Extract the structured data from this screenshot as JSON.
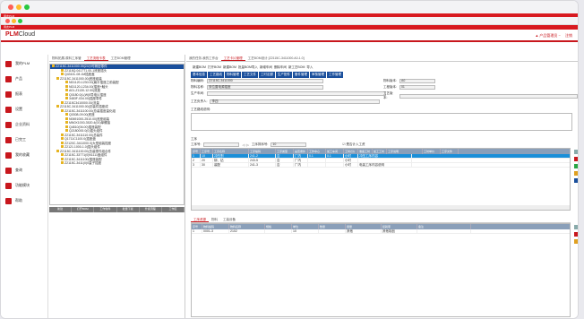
{
  "window": {
    "title1": "用友PLM",
    "title2": "用友PLM"
  },
  "app": {
    "logo_prefix": "PLM",
    "logo_suffix": "Cloud",
    "user": "产品管理员 ~",
    "logout": "注销"
  },
  "sidebar": {
    "items": [
      {
        "label": "我的PLM"
      },
      {
        "label": "产品"
      },
      {
        "label": "报表"
      },
      {
        "label": "设置"
      },
      {
        "label": "企业资料"
      },
      {
        "label": "已完工"
      },
      {
        "label": "我的收藏"
      },
      {
        "label": "查询"
      },
      {
        "label": "功能模块"
      },
      {
        "label": "帮助"
      }
    ]
  },
  "tree": {
    "tabs": [
      "物料拓展-原料工序管",
      "工艺流程卡表",
      "工艺BOM管理"
    ],
    "nodes": [
      {
        "text": "Z2115C-3411000.09(24小时精密零件",
        "sel": true,
        "indent": 0
      },
      {
        "text": "Z2115Q.0417T1.00-1底座插头",
        "indent": 2
      },
      {
        "text": "Q4310L.08.1M插座盖",
        "indent": 2
      },
      {
        "text": "Z2115C-3411000.00(底座组装",
        "indent": 1
      },
      {
        "text": "ND1120-1230.00(扁平插座之前装配",
        "indent": 3
      },
      {
        "text": "ND1120-1234.00(插座+触头",
        "indent": 3
      },
      {
        "text": "A01-Z1130-12.00(底座",
        "indent": 3
      },
      {
        "text": "Q0180.0(L(W)5导电片插座",
        "indent": 3
      },
      {
        "text": "3483F-034.00(插座零件",
        "indent": 3
      },
      {
        "text": "Z2115C3410000.00(流量",
        "indent": 2
      },
      {
        "text": "Z2115C-3411000.00(总装件插座成",
        "indent": 1
      },
      {
        "text": "Z2115C-3411100.00(总装插座量化组",
        "indent": 2
      },
      {
        "text": "Q0308-09.00(底座",
        "indent": 3
      },
      {
        "text": "N0691000-2510.00(底座组装",
        "indent": 3
      },
      {
        "text": "MN0X1000-3520.4(00)单螺接",
        "indent": 3
      },
      {
        "text": "Q4810(06.00)插座装配",
        "indent": 3
      },
      {
        "text": "Q2180000.0(0)插头组件",
        "indent": 3
      },
      {
        "text": "Z2115C-3411110.00(总装件",
        "indent": 2
      },
      {
        "text": "Q1711C1100.0(插座盘",
        "indent": 2
      },
      {
        "text": "Z2120C-3411000.0(大型组装插座",
        "indent": 2
      },
      {
        "text": "Z2121.1000-1.0(插头组件",
        "indent": 2
      },
      {
        "text": "Z2115C-3411100.00(总装零件组合件",
        "indent": 1
      },
      {
        "text": "Z2115C-33771(0)N1111盘组件",
        "indent": 2
      },
      {
        "text": "Z2115C-3411100(插座装配",
        "indent": 2
      },
      {
        "text": "Z2115C-3411(0)0量子插座",
        "indent": 2
      }
    ],
    "buttons": [
      "新建",
      "打开BOM",
      "工作零件",
      "批量下载",
      "升级流程",
      "工作区"
    ]
  },
  "main": {
    "tabs": [
      "我的任务-我的工作台",
      "工艺卡片管理",
      "工艺BOM设计 [Z2115C-3411000.A0-1.0]"
    ],
    "toolbar": [
      "新建BOM",
      "打开BOM",
      "新建BOM",
      "批量BOM导入",
      "新增车间",
      "删除车间",
      "新工艺BOM",
      "导入"
    ],
    "actions": [
      "基本信息",
      "工艺路线",
      "物料管理",
      "工艺文件",
      "工时定额",
      "生产配件",
      "备件管理",
      "审核管理",
      "工作管理"
    ],
    "form": {
      "code_label": "物料编码:",
      "code": "Z2115C-3411000",
      "name_label": "物料名称:",
      "name": "双位置电源插座",
      "attr_label": "物料版本:",
      "attr": "A0",
      "attr2_label": "工程版本:",
      "attr2": "01",
      "workshop_label": "生产车间:",
      "workshop": "",
      "process_label": "工艺版本:",
      "process": "",
      "owner_label": "工艺负责人:",
      "owner": "李四",
      "note_label": "工艺路线说明:"
    },
    "ops": {
      "title": "工序",
      "label1": "工序号:",
      "label2": "工序排序号:",
      "seq": "10",
      "checkbox": "是否计入工资",
      "headers": [
        "序号",
        "工序号",
        "工序名称",
        "工序编码",
        "工序类型",
        "是否委外",
        "工作中心",
        "加工车间",
        "工时(分)",
        "准备工时",
        "加工工时",
        "工序说明",
        "工时单价",
        "工序文件"
      ],
      "rows": [
        {
          "no": "1",
          "code": "10",
          "name": "冲压割",
          "c": "241-2",
          "t": "否",
          "wc": "厂内",
          "v": "0.1",
          "v2": "0.1",
          "u": "小时",
          "d": "冲压工序内容",
          "sel": true
        },
        {
          "no": "2",
          "code": "20",
          "name": "铆、钻",
          "c": "243-5",
          "t": "否",
          "wc": "厂内",
          "v": "",
          "v2": "",
          "u": "小时",
          "d": "",
          "sel": false
        },
        {
          "no": "3",
          "code": "30",
          "name": "装配",
          "c": "241-3",
          "t": "否",
          "wc": "厂内",
          "v": "",
          "v2": "",
          "u": "小时",
          "d": "电装工序内容说明",
          "sel": false
        }
      ]
    },
    "bottom": {
      "tabs": [
        "工序资源",
        "物料",
        "工装设备"
      ],
      "headers": [
        "序号",
        "物料编码",
        "物料名称",
        "规格",
        "单位",
        "数量",
        "用量",
        "损耗率",
        "备注"
      ],
      "rows": [
        {
          "no": "1",
          "code": "0001-3",
          "name": "2102",
          "spec": "",
          "unit": "10",
          "qty": "",
          "use": "其他",
          "loss": "其他制品",
          "memo": ""
        }
      ]
    }
  }
}
